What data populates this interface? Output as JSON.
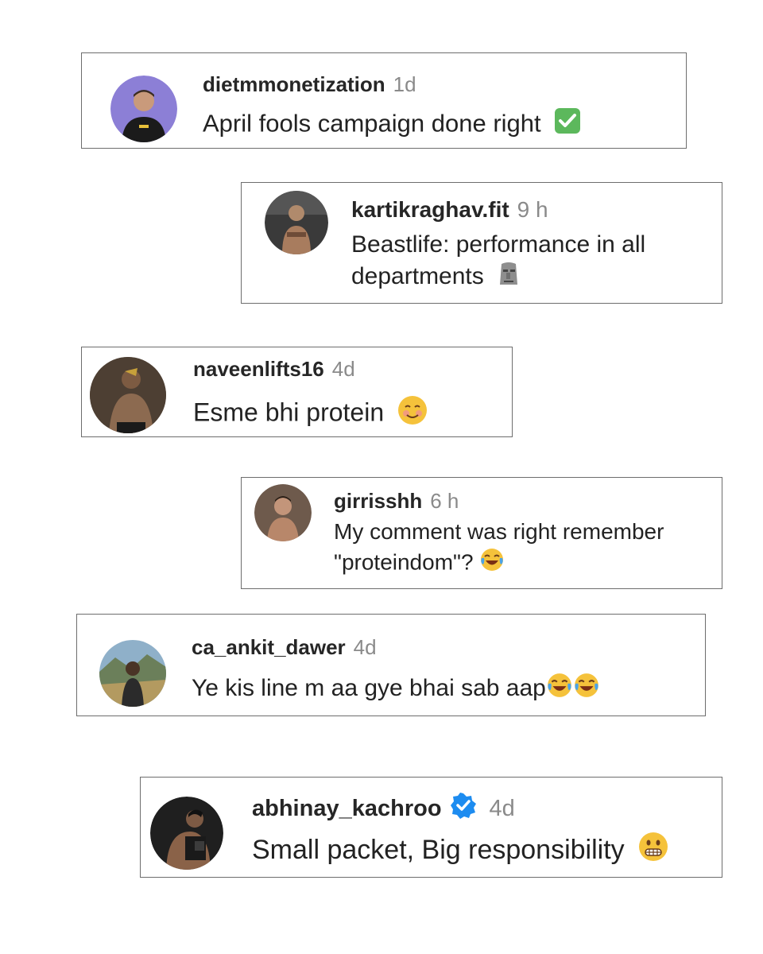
{
  "comments": [
    {
      "username": "dietmmonetization",
      "time": "1d",
      "text": "April fools campaign done right",
      "emoji": "check-mark-button-emoji",
      "avatar_bg": "#8c7fd6"
    },
    {
      "username": "kartikraghav.fit",
      "time": "9 h",
      "text_line1": "Beastlife: performance in all",
      "text_line2": "departments",
      "emoji": "moai-emoji",
      "avatar_bg": "#3a3a3a"
    },
    {
      "username": "naveenlifts16",
      "time": "4d",
      "text": "Esme bhi protein",
      "emoji": "smiling-face-emoji",
      "avatar_bg": "#5b4a3a"
    },
    {
      "username": "girrisshh",
      "time": "6 h",
      "text_line1": "My comment was right remember",
      "text_line2": "\"proteindom\"?",
      "emoji": "tears-of-joy-emoji",
      "avatar_bg": "#6e5a4c"
    },
    {
      "username": "ca_ankit_dawer",
      "time": "4d",
      "text": "Ye kis line m aa gye bhai sab aap",
      "emoji": "tears-of-joy-emoji",
      "avatar_bg": "#8fb0c9"
    },
    {
      "username": "abhinay_kachroo",
      "time": "4d",
      "text": "Small packet, Big responsibility",
      "emoji": "grimacing-face-emoji",
      "verified": true,
      "avatar_bg": "#1f1f1f"
    }
  ],
  "colors": {
    "border": "#6d6d6d",
    "username": "#262626",
    "timestamp": "#8a8a8a",
    "verified": "#1d8cf0"
  }
}
